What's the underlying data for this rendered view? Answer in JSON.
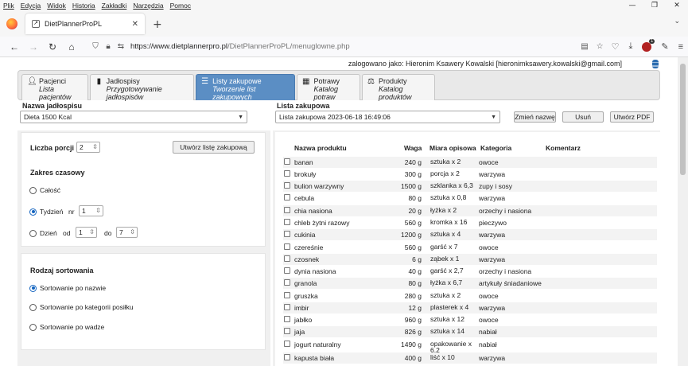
{
  "browser": {
    "menu": [
      "Plik",
      "Edycja",
      "Widok",
      "Historia",
      "Zakładki",
      "Narzędzia",
      "Pomoc"
    ],
    "tab_title": "DietPlannerProPL",
    "url_domain": "https://www.dietplannerpro.pl",
    "url_path": "/DietPlannerProPL/menuglowne.php"
  },
  "header": {
    "login_text": "zalogowano jako: Hieronim Ksawery Kowalski [hieronimksawery.kowalski@gmail.com]"
  },
  "tabs": [
    {
      "title": "Pacjenci",
      "subtitle": "Lista pacjentów",
      "icon": "person-icon"
    },
    {
      "title": "Jadłospisy",
      "subtitle": "Przygotowywanie jadłospisów",
      "icon": "book-icon"
    },
    {
      "title": "Listy zakupowe",
      "subtitle": "Tworzenie list zakupowych",
      "icon": "list-icon"
    },
    {
      "title": "Potrawy",
      "subtitle": "Katalog potraw",
      "icon": "dish-icon"
    },
    {
      "title": "Produkty",
      "subtitle": "Katalog produktów",
      "icon": "scale-icon"
    }
  ],
  "menu_select": {
    "label": "Nazwa jadłospisu",
    "value": "Dieta 1500 Kcal"
  },
  "list_select": {
    "label": "Lista zakupowa",
    "value": "Lista zakupowa 2023-06-18 16:49:06"
  },
  "buttons": {
    "rename": "Zmień nazwę",
    "delete": "Usuń",
    "pdf": "Utwórz PDF",
    "create_list": "Utwórz listę zakupową"
  },
  "portions": {
    "label": "Liczba porcji",
    "value": "2"
  },
  "time_range": {
    "label": "Zakres czasowy",
    "all": "Całość",
    "week": "Tydzień",
    "week_nr_label": "nr",
    "week_nr": "1",
    "day": "Dzień",
    "from_label": "od",
    "from": "1",
    "to_label": "do",
    "to": "7"
  },
  "sorting": {
    "label": "Rodzaj sortowania",
    "by_name": "Sortowanie po nazwie",
    "by_category": "Sortowanie po kategorii posiłku",
    "by_weight": "Sortowanie po wadze"
  },
  "table": {
    "headers": [
      "Nazwa produktu",
      "Waga",
      "Miara opisowa",
      "Kategoria",
      "Komentarz"
    ],
    "rows": [
      [
        "banan",
        "240 g",
        "sztuka x 2",
        "owoce"
      ],
      [
        "brokuły",
        "300 g",
        "porcja x 2",
        "warzywa"
      ],
      [
        "bulion warzywny",
        "1500 g",
        "szklanka x 6,3",
        "zupy i sosy"
      ],
      [
        "cebula",
        "80 g",
        "sztuka x 0,8",
        "warzywa"
      ],
      [
        "chia nasiona",
        "20 g",
        "łyżka x 2",
        "orzechy i nasiona"
      ],
      [
        "chleb żytni razowy",
        "560 g",
        "kromka x 16",
        "pieczywo"
      ],
      [
        "cukinia",
        "1200 g",
        "sztuka x 4",
        "warzywa"
      ],
      [
        "czereśnie",
        "560 g",
        "garść x 7",
        "owoce"
      ],
      [
        "czosnek",
        "6 g",
        "ząbek x 1",
        "warzywa"
      ],
      [
        "dynia nasiona",
        "40 g",
        "garść x 2,7",
        "orzechy i nasiona"
      ],
      [
        "granola",
        "80 g",
        "łyżka x 6,7",
        "artykuły śniadaniowe"
      ],
      [
        "gruszka",
        "280 g",
        "sztuka x 2",
        "owoce"
      ],
      [
        "imbir",
        "12 g",
        "plasterek x 4",
        "warzywa"
      ],
      [
        "jabłko",
        "960 g",
        "sztuka x 12",
        "owoce"
      ],
      [
        "jaja",
        "826 g",
        "sztuka x 14",
        "nabiał"
      ],
      [
        "jogurt naturalny",
        "1490 g",
        "opakowanie x 6,2",
        "nabiał"
      ],
      [
        "kapusta biała",
        "400 g",
        "liść x 10",
        "warzywa"
      ]
    ]
  }
}
